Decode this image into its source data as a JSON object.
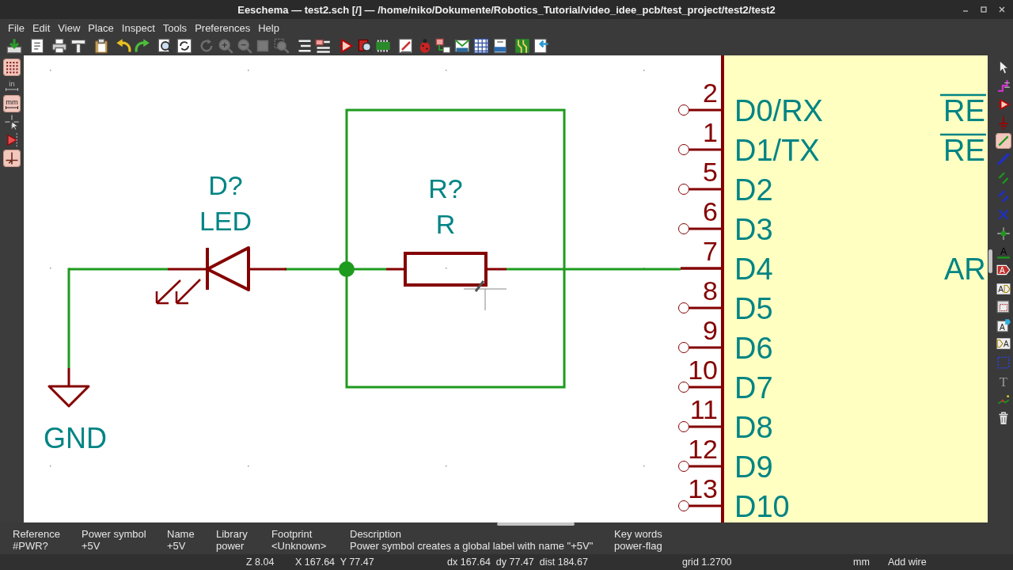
{
  "window": {
    "title": "Eeschema — test2.sch [/] — /home/niko/Dokumente/Robotics_Tutorial/video_idee_pcb/test_project/test2/test2"
  },
  "menu": [
    "File",
    "Edit",
    "View",
    "Place",
    "Inspect",
    "Tools",
    "Preferences",
    "Help"
  ],
  "toolbar": [
    {
      "disabled": false
    },
    {
      "disabled": false
    },
    {
      "disabled": false
    },
    {
      "disabled": false
    },
    {
      "disabled": false
    },
    {
      "disabled": false
    },
    {
      "disabled": false
    },
    {
      "disabled": false
    },
    {
      "disabled": false
    },
    {
      "disabled": true
    },
    {
      "disabled": true
    },
    {
      "disabled": true
    },
    {
      "disabled": true
    },
    {
      "disabled": true
    },
    {
      "disabled": false
    },
    {
      "disabled": false
    },
    {
      "disabled": false
    },
    {
      "disabled": false
    },
    {
      "disabled": false
    },
    {
      "disabled": false
    },
    {
      "disabled": false
    },
    {
      "disabled": false
    },
    {
      "disabled": false
    },
    {
      "disabled": false
    },
    {
      "disabled": false
    },
    {
      "disabled": false
    },
    {
      "disabled": false
    }
  ],
  "left_toolbar": [
    {
      "on": true
    },
    {
      "label": "in",
      "on": false
    },
    {
      "label": "mm",
      "on": true
    },
    {
      "on": false
    },
    {
      "on": false
    },
    {
      "on": true
    }
  ],
  "right_toolbar": [
    {
      "selected": false
    },
    {
      "selected": false
    },
    {
      "selected": false
    },
    {
      "selected": false
    },
    {
      "selected": true
    },
    {
      "selected": false
    },
    {
      "selected": false
    },
    {
      "selected": false
    },
    {
      "selected": false
    },
    {
      "selected": false
    },
    {
      "selected": false,
      "glyph": "A"
    },
    {
      "selected": false,
      "glyph": "A"
    },
    {
      "selected": false,
      "glyph": "A"
    },
    {
      "selected": false
    },
    {
      "selected": false,
      "glyph": "A"
    },
    {
      "selected": false,
      "glyph": "A"
    },
    {
      "selected": false
    },
    {
      "selected": false,
      "glyph": "T"
    },
    {
      "selected": false
    },
    {
      "selected": false
    }
  ],
  "schematic": {
    "symbols": [
      {
        "kind": "led",
        "reference": "D?",
        "value": "LED"
      },
      {
        "kind": "resistor",
        "reference": "R?",
        "value": "R"
      },
      {
        "kind": "power",
        "value": "GND"
      }
    ],
    "component": {
      "pins": [
        {
          "number": "2",
          "name": "D0/RX",
          "connected": false
        },
        {
          "number": "1",
          "name": "D1/TX",
          "connected": false
        },
        {
          "number": "5",
          "name": "D2",
          "connected": false
        },
        {
          "number": "6",
          "name": "D3",
          "connected": false
        },
        {
          "number": "7",
          "name": "D4",
          "connected": true
        },
        {
          "number": "8",
          "name": "D5",
          "connected": false
        },
        {
          "number": "9",
          "name": "D6",
          "connected": false
        },
        {
          "number": "10",
          "name": "D7",
          "connected": false
        },
        {
          "number": "11",
          "name": "D8",
          "connected": false
        },
        {
          "number": "12",
          "name": "D9",
          "connected": false
        },
        {
          "number": "13",
          "name": "D10",
          "connected": false
        }
      ],
      "right_pins": [
        {
          "name": "RE",
          "overbar": true
        },
        {
          "name": "RE",
          "overbar": true
        },
        {
          "name": "AR",
          "overbar": false
        }
      ]
    }
  },
  "message_panel": [
    {
      "label": "Reference",
      "value": "#PWR?"
    },
    {
      "label": "Power symbol",
      "value": "+5V"
    },
    {
      "label": "Name",
      "value": "+5V"
    },
    {
      "label": "Library",
      "value": "power"
    },
    {
      "label": "Footprint",
      "value": "<Unknown>"
    },
    {
      "label": "Description",
      "value": "Power symbol creates a global label with name \"+5V\""
    },
    {
      "label": "Key words",
      "value": "power-flag"
    }
  ],
  "status_bar": {
    "zoom": "Z 8.04",
    "position": "X 167.64  Y 77.47",
    "delta": "dx 167.64  dy 77.47  dist 184.67",
    "grid": "grid 1.2700",
    "units": "mm",
    "tool": "Add wire"
  }
}
